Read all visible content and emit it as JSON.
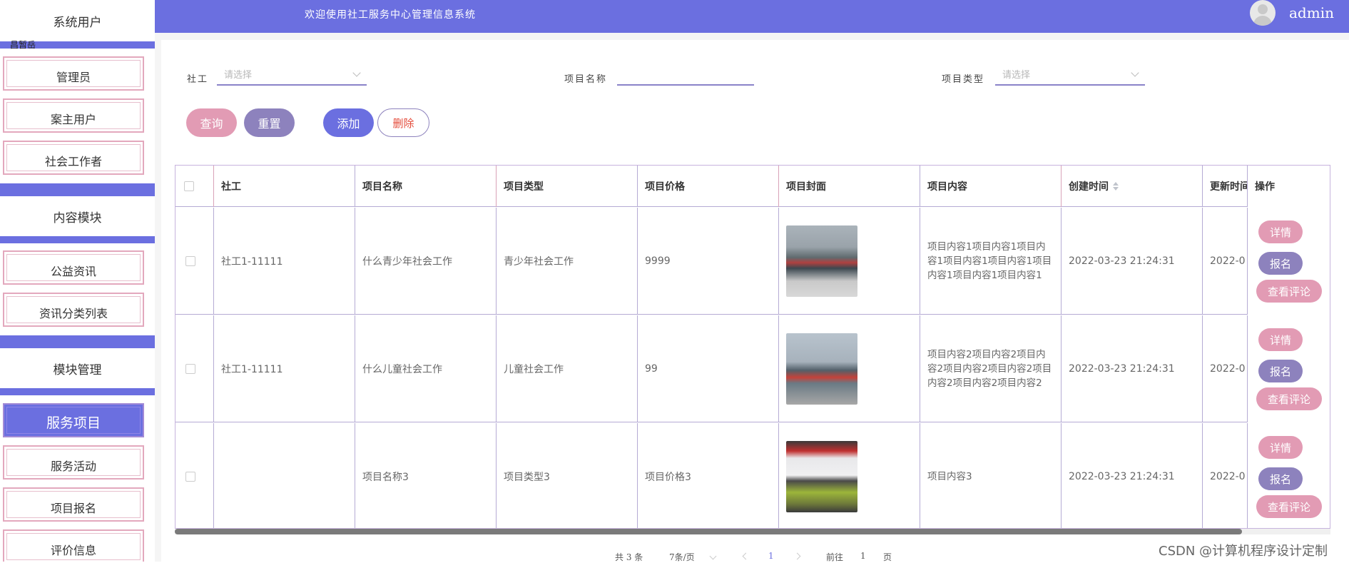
{
  "sidebar": {
    "groups": [
      {
        "label": "系统用户"
      },
      {
        "label": "内容模块"
      },
      {
        "label": "模块管理"
      }
    ],
    "items": [
      {
        "label": "管理员"
      },
      {
        "label": "案主用户"
      },
      {
        "label": "社会工作者"
      },
      {
        "label": "公益资讯"
      },
      {
        "label": "资讯分类列表"
      },
      {
        "label": "服务项目"
      },
      {
        "label": "服务活动"
      },
      {
        "label": "项目报名"
      },
      {
        "label": "评价信息"
      }
    ],
    "tiny_label": "昌暂岳"
  },
  "header": {
    "title": "欢迎使用社工服务中心管理信息系统",
    "username": "admin"
  },
  "filters": {
    "social_worker_label": "社工",
    "social_worker_placeholder": "请选择",
    "project_name_label": "项目名称",
    "project_name_value": "",
    "project_type_label": "项目类型",
    "project_type_placeholder": "请选择"
  },
  "actions": {
    "query": "查询",
    "reset": "重置",
    "add": "添加",
    "delete": "删除"
  },
  "table": {
    "headers": [
      "社工",
      "项目名称",
      "项目类型",
      "项目价格",
      "项目封面",
      "项目内容",
      "创建时间",
      "更新时间",
      "操作"
    ],
    "rows": [
      {
        "worker": "社工1-11111",
        "name": "什么青少年社会工作",
        "type": "青少年社会工作",
        "price": "9999",
        "cover": "cover-photo-1",
        "content": "项目内容1项目内容1项目内容1项目内容1项目内容1项目内容1项目内容1项目内容1",
        "created": "2022-03-23 21:24:31",
        "updated": "2022-0"
      },
      {
        "worker": "社工1-11111",
        "name": "什么儿童社会工作",
        "type": "儿童社会工作",
        "price": "99",
        "cover": "cover-photo-2",
        "content": "项目内容2项目内容2项目内容2项目内容2项目内容2项目内容2项目内容2项目内容2",
        "created": "2022-03-23 21:24:31",
        "updated": "2022-0"
      },
      {
        "worker": "",
        "name": "项目名称3",
        "type": "项目类型3",
        "price": "项目价格3",
        "cover": "cover-photo-3",
        "content": "项目内容3",
        "created": "2022-03-23 21:24:31",
        "updated": "2022-0"
      }
    ],
    "row_actions": {
      "detail": "详情",
      "signup": "报名",
      "comments": "查看评论"
    }
  },
  "pagination": {
    "total": "共 3 条",
    "page_size": "7条/页",
    "current_page": "1",
    "goto_label": "前往",
    "goto_value": "1",
    "page_suffix": "页"
  },
  "watermark": "CSDN @计算机程序设计定制",
  "colors": {
    "primary": "#6b6fe0",
    "pink": "#e29bb4",
    "purple": "#8d82bd",
    "danger": "#e44b3a"
  }
}
